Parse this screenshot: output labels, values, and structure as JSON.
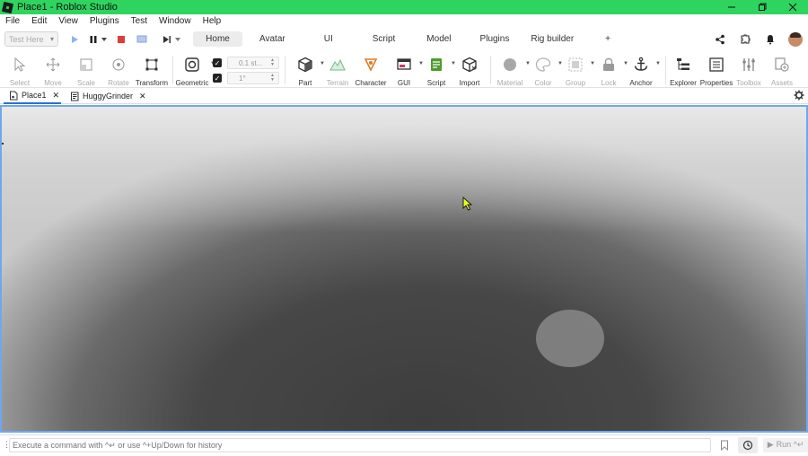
{
  "window": {
    "title": "Place1 - Roblox Studio"
  },
  "menu": [
    "File",
    "Edit",
    "View",
    "Plugins",
    "Test",
    "Window",
    "Help"
  ],
  "test_bar": {
    "selector_value": "Test Here"
  },
  "ribbon_tabs": [
    "Home",
    "Avatar",
    "UI",
    "Script",
    "Model",
    "Plugins",
    "Rig builder",
    "+"
  ],
  "ribbon_active_tab": "Home",
  "tools": {
    "select": "Select",
    "move": "Move",
    "scale": "Scale",
    "rotate": "Rotate",
    "transform": "Transform",
    "geometric": "Geometric",
    "part": "Part",
    "terrain": "Terrain",
    "character": "Character",
    "gui": "GUI",
    "script": "Script",
    "import": "Import",
    "material": "Material",
    "color": "Color",
    "group": "Group",
    "lock": "Lock",
    "anchor": "Anchor",
    "explorer": "Explorer",
    "properties": "Properties",
    "toolbox": "Toolbox",
    "assets": "Assets"
  },
  "snap": {
    "move_value": "0.1 st...",
    "rotate_value": "1°"
  },
  "doc_tabs": [
    {
      "label": "Place1"
    },
    {
      "label": "HuggyGrinder"
    }
  ],
  "command_bar": {
    "placeholder": "Execute a command with ^↵ or use ^+Up/Down for history",
    "run_label": "Run ^↵"
  },
  "colors": {
    "titlebar": "#2fd45f",
    "viewport_border": "#6fa7ef",
    "stop_red": "#e23b3b",
    "play_blue": "#5b8def"
  }
}
